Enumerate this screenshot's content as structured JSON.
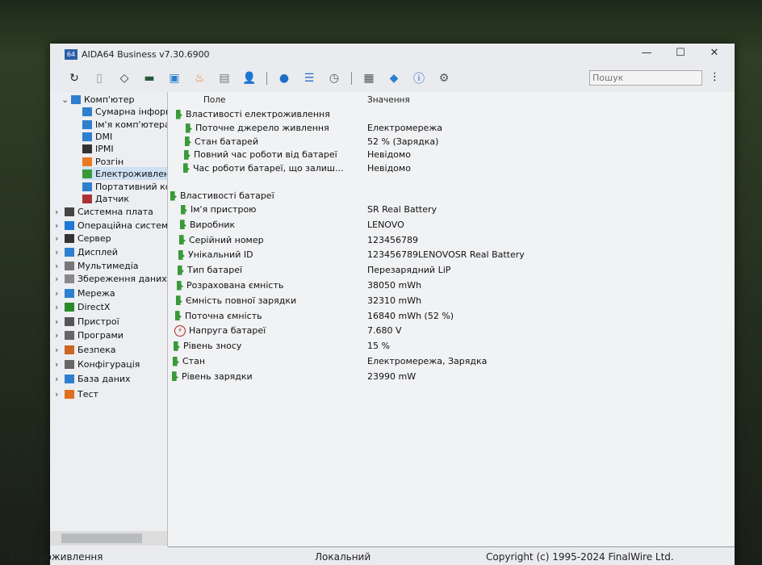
{
  "window": {
    "title": "AIDA64 Business v7.30.6900",
    "logo": "64",
    "minimize": "—",
    "maximize": "☐",
    "close": "✕"
  },
  "toolbar": {
    "icons": [
      "refresh-icon",
      "report-icon",
      "cpu-icon",
      "memory-icon",
      "computer-icon",
      "overclock-icon",
      "cache-icon",
      "user-icon",
      "network-icon",
      "database-icon",
      "benchmark-icon",
      "monitor-icon",
      "update-icon",
      "info-icon",
      "tools-icon"
    ],
    "search_placeholder": "Пошук",
    "menu": "⋮"
  },
  "tree": [
    {
      "label": "Комп'ютер",
      "level": 0,
      "expanded": true,
      "color": "#2f7fcf"
    },
    {
      "label": "Сумарна інформація",
      "level": 1,
      "color": "#2f7fcf"
    },
    {
      "label": "Ім'я комп'ютера",
      "level": 1,
      "color": "#2f7fcf"
    },
    {
      "label": "DMI",
      "level": 1,
      "color": "#2f7fcf"
    },
    {
      "label": "IPMI",
      "level": 1,
      "color": "#333"
    },
    {
      "label": "Розгін",
      "level": 1,
      "color": "#e77a22"
    },
    {
      "label": "Електроживлення",
      "level": 1,
      "selected": true,
      "color": "#3a9a3a"
    },
    {
      "label": "Портативний комп'юте",
      "level": 1,
      "color": "#2f7fcf"
    },
    {
      "label": "Датчик",
      "level": 1,
      "color": "#a33"
    },
    {
      "label": "Системна плата",
      "level": 0,
      "color": "#444"
    },
    {
      "label": "Операційна система",
      "level": 0,
      "color": "#1e78d4"
    },
    {
      "label": "Сервер",
      "level": 0,
      "color": "#333"
    },
    {
      "label": "Дисплей",
      "level": 0,
      "color": "#2f7fcf"
    },
    {
      "label": "Мультимедіа",
      "level": 0,
      "color": "#777"
    },
    {
      "label": "Збереження даних",
      "level": 0,
      "color": "#888"
    },
    {
      "label": "Мережа",
      "level": 0,
      "color": "#2f7fcf"
    },
    {
      "label": "DirectX",
      "level": 0,
      "color": "#2a8a2a"
    },
    {
      "label": "Пристрої",
      "level": 0,
      "color": "#555"
    },
    {
      "label": "Програми",
      "level": 0,
      "color": "#666"
    },
    {
      "label": "Безпека",
      "level": 0,
      "color": "#c62"
    },
    {
      "label": "Конфігурація",
      "level": 0,
      "color": "#666"
    },
    {
      "label": "База даних",
      "level": 0,
      "color": "#2f7fcf"
    },
    {
      "label": "Тест",
      "level": 0,
      "color": "#e07020"
    }
  ],
  "main": {
    "col_field": "Поле",
    "col_value": "Значення",
    "groups": [
      {
        "title": "Властивості електроживлення",
        "rows": [
          {
            "field": "Поточне джерело живлення",
            "value": "Електромережа"
          },
          {
            "field": "Стан батарей",
            "value": "52 % (Зарядка)"
          },
          {
            "field": "Повний час роботи від батареї",
            "value": "Невідомо"
          },
          {
            "field": "Час роботи батареї, що залиш...",
            "value": "Невідомо"
          }
        ]
      },
      {
        "title": "Властивості батареї",
        "rows": [
          {
            "field": "Ім'я пристрою",
            "value": "SR Real Battery"
          },
          {
            "field": "Виробник",
            "value": "LENOVO"
          },
          {
            "field": "Серійний номер",
            "value": "123456789"
          },
          {
            "field": "Унікальний ID",
            "value": "123456789LENOVOSR Real Battery"
          },
          {
            "field": "Тип батареї",
            "value": "Перезарядний LiP"
          },
          {
            "field": "Розрахована ємність",
            "value": "38050 mWh"
          },
          {
            "field": "Ємність повної зарядки",
            "value": "32310 mWh"
          },
          {
            "field": "Поточна ємність",
            "value": "16840 mWh  (52 %)"
          },
          {
            "field": "Напруга батареї",
            "value": "7.680 V",
            "icon": "voltage"
          },
          {
            "field": "Рівень зносу",
            "value": "15 %"
          },
          {
            "field": "Стан",
            "value": "Електромережа, Зарядка"
          },
          {
            "field": "Рівень зарядки",
            "value": "23990 mW"
          }
        ]
      }
    ]
  },
  "status": {
    "left": "Електроживлення",
    "middle": "Локальний",
    "right": "Copyright (c) 1995-2024 FinalWire Ltd."
  }
}
